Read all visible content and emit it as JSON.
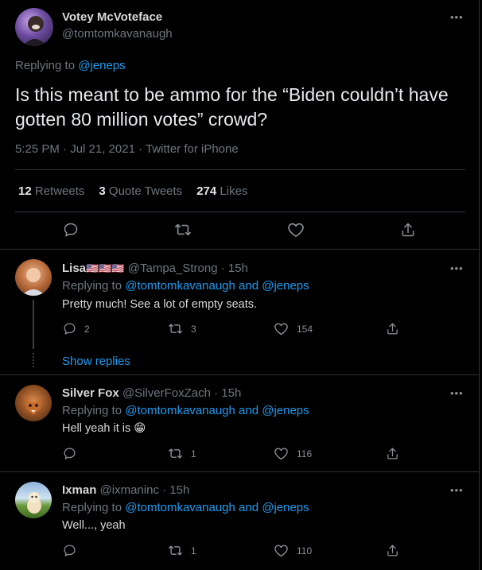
{
  "main": {
    "author_name": "Votey McVoteface",
    "author_handle": "@tomtomkavanaugh",
    "replying_prefix": "Replying to",
    "replying_handle": "@jeneps",
    "text": "Is this meant to be ammo for the “Biden couldn’t have gotten 80 million votes” crowd?",
    "meta": "5:25 PM · Jul 21, 2021 · Twitter for iPhone",
    "stats": {
      "retweets_count": "12",
      "retweets_label": "Retweets",
      "quotes_count": "3",
      "quotes_label": "Quote Tweets",
      "likes_count": "274",
      "likes_label": "Likes"
    },
    "more": "•••"
  },
  "replies": [
    {
      "name": "Lisa",
      "flags": "🇺🇸🇺🇸🇺🇸",
      "handle_time": "@Tampa_Strong · 15h",
      "replying_prefix": "Replying to",
      "replying_to": "@tomtomkavanaugh and @jeneps",
      "text": "Pretty much! See a lot of empty seats.",
      "reply_count": "2",
      "retweet_count": "3",
      "like_count": "154",
      "show_replies": "Show replies"
    },
    {
      "name": "Silver Fox",
      "handle_time": "@SilverFoxZach · 15h",
      "replying_prefix": "Replying to",
      "replying_to": "@tomtomkavanaugh and @jeneps",
      "text": "Hell yeah it is 😁",
      "reply_count": "",
      "retweet_count": "1",
      "like_count": "116"
    },
    {
      "name": "Ixman",
      "handle_time": "@ixmaninc · 15h",
      "replying_prefix": "Replying to",
      "replying_to": "@tomtomkavanaugh and @jeneps",
      "text": "Well..., yeah",
      "reply_count": "",
      "retweet_count": "1",
      "like_count": "110"
    }
  ],
  "colors": {
    "link": "#1d9bf0",
    "muted": "#6e767d",
    "bg": "#000000",
    "divider": "#2f3336"
  }
}
